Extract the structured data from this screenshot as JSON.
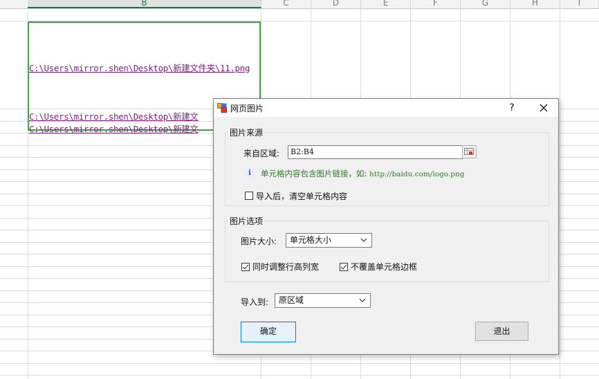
{
  "sheet": {
    "columns": [
      "B",
      "C",
      "D",
      "E",
      "F",
      "G",
      "H",
      "I"
    ],
    "links": {
      "b2": "C:\\Users\\mirror.shen\\Desktop\\新建文件夹\\11.png",
      "b3": "C:\\Users\\mirror.shen\\Desktop\\新建文",
      "b4": "C:\\Users\\mirror.shen\\Desktop\\新建文"
    }
  },
  "dialog": {
    "title": "网页图片",
    "help": "?",
    "source_group": {
      "title": "图片来源",
      "range_label": "来自区域:",
      "range_value": "B2:B4",
      "hint_text": "单元格内容包含图片链接，如:",
      "hint_url": "http://baidu.com/logo.png",
      "clear_after_import_label": "导入后，清空单元格内容",
      "clear_after_import_checked": false
    },
    "options_group": {
      "title": "图片选项",
      "size_label": "图片大小:",
      "size_value": "单元格大小",
      "adjust_row_col_label": "同时调整行高列宽",
      "adjust_row_col_checked": true,
      "no_cover_border_label": "不覆盖单元格边框",
      "no_cover_border_checked": true
    },
    "import_to_label": "导入到:",
    "import_to_value": "原区域",
    "ok_label": "确定",
    "exit_label": "退出"
  },
  "colors": {
    "selection_border": "#3ea33e",
    "link_color": "#7a1f7a",
    "hint_color": "#2a7a22",
    "primary_border": "#0078d7"
  }
}
